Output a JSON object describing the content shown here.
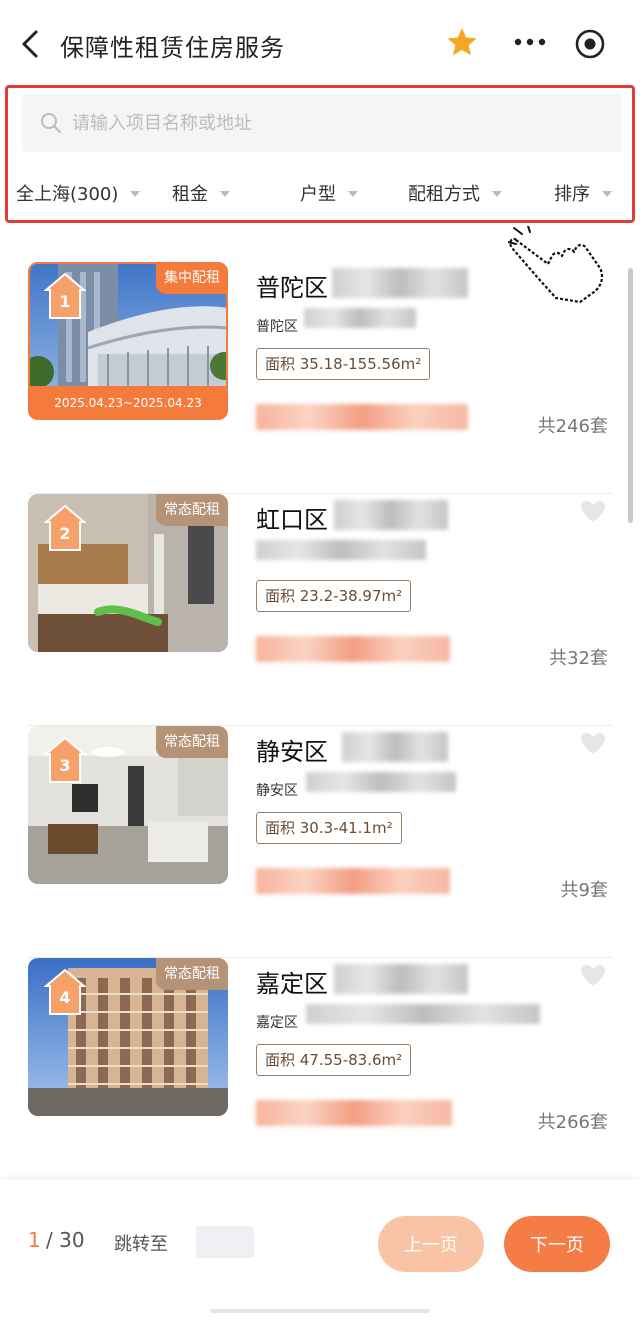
{
  "header": {
    "title": "保障性租赁住房服务",
    "accent": "#f5a623"
  },
  "search": {
    "placeholder": "请输入项目名称或地址"
  },
  "filters": [
    {
      "label": "全上海(300)"
    },
    {
      "label": "租金"
    },
    {
      "label": "户型"
    },
    {
      "label": "配租方式"
    },
    {
      "label": "排序"
    }
  ],
  "listings": [
    {
      "rank": "1",
      "type_tag": "集中配租",
      "date_range": "2025.04.23~2025.04.23",
      "district": "普陀区",
      "sub": "普陀区",
      "area": "面积 35.18-155.56m²",
      "count": "共246套"
    },
    {
      "rank": "2",
      "type_tag": "常态配租",
      "district": "虹口区",
      "area": "面积 23.2-38.97m²",
      "count": "共32套"
    },
    {
      "rank": "3",
      "type_tag": "常态配租",
      "district": "静安区",
      "sub": "静安区",
      "area": "面积 30.3-41.1m²",
      "count": "共9套"
    },
    {
      "rank": "4",
      "type_tag": "常态配租",
      "district": "嘉定区",
      "sub": "嘉定区",
      "area": "面积 47.55-83.6m²",
      "count": "共266套"
    }
  ],
  "pager": {
    "current": "1",
    "total": "/ 30",
    "jump_label": "跳转至",
    "prev": "上一页",
    "next": "下一页"
  },
  "colors": {
    "brand": "#f57d45",
    "highlight_border": "#e53935"
  }
}
